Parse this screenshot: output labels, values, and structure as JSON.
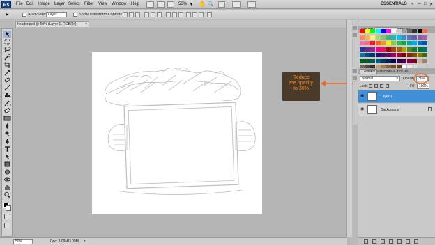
{
  "app": {
    "logo": "Ps",
    "menus": [
      "File",
      "Edit",
      "Image",
      "Layer",
      "Select",
      "Filter",
      "View",
      "Window",
      "Help"
    ],
    "zoom_select": "50%",
    "workspace": "ESSENTIALS"
  },
  "options_bar": {
    "auto_select_label": "Auto-Select:",
    "auto_select_value": "Layer",
    "show_transform_label": "Show Transform Controls"
  },
  "document": {
    "tab_title": "header.psd @ 50% (Layer 1, RGB/8#)",
    "tab_close": "×"
  },
  "status": {
    "zoom": "50%",
    "doc_size": "Doc: 3.09M/3.09M"
  },
  "panels": {
    "color_tabs": [
      "COLOR",
      "SWATCHES",
      "STYLES"
    ],
    "layers_tabs": [
      "LAYERS",
      "CHANNELS",
      "PATHS"
    ],
    "blend_mode": "Normal",
    "opacity_label": "Opacity:",
    "opacity_value": "30%",
    "lock_label": "Lock:",
    "fill_label": "Fill:",
    "fill_value": "100%",
    "layers": [
      {
        "name": "Layer 1",
        "selected": true
      },
      {
        "name": "Background",
        "selected": false
      }
    ],
    "swatch_colors": [
      "#ff0000",
      "#ffff00",
      "#00ff00",
      "#00ffff",
      "#0000ff",
      "#ff00ff",
      "#ffffff",
      "#cccccc",
      "#999999",
      "#666666",
      "#333333",
      "#000000",
      "#f26c4f",
      "#f68e55",
      "#fbaf5c",
      "#fff467",
      "#acd372",
      "#7cc576",
      "#3bb878",
      "#1abbb4",
      "#00bff3",
      "#438ccb",
      "#5574b9",
      "#605ca8",
      "#855fa8",
      "#a763a8",
      "#f06ea9",
      "#f26d7d",
      "#ed1c24",
      "#f26522",
      "#f7941d",
      "#fff200",
      "#8dc63f",
      "#39b54a",
      "#00a651",
      "#00a99d",
      "#00aeef",
      "#0072bc",
      "#0054a6",
      "#2e3192",
      "#662d91",
      "#92278f",
      "#ec008c",
      "#ed145b",
      "#9e0b0f",
      "#a0410d",
      "#a3620a",
      "#aba000",
      "#598527",
      "#197b30",
      "#007236",
      "#00746b",
      "#0076a3",
      "#004b80",
      "#003471",
      "#1b1464",
      "#440e62",
      "#630460",
      "#9e005d",
      "#9e0039",
      "#790000",
      "#7b2e00",
      "#7d4900",
      "#827b00",
      "#406618",
      "#005e20",
      "#005826",
      "#005952",
      "#005b7f",
      "#003663",
      "#002157",
      "#0d004c",
      "#32004b",
      "#4b0049",
      "#7b0046",
      "#7a0026",
      "#c7b299",
      "#998675",
      "#736357",
      "#534741",
      "#37302a",
      "#c69c6d",
      "#a67c52",
      "#8c6239",
      "#754c24",
      "#603913",
      "#ffffff",
      "#ebebeb",
      "#d7d7d7"
    ]
  },
  "callout": {
    "line1": "Reduce",
    "line2": "the opacity",
    "line3": "to 30%",
    "color": "#ff8a1e",
    "bg": "#4a3a2a"
  },
  "colors": {
    "accent_selection": "#3f8fd9",
    "arrow": "#e86a2a"
  }
}
